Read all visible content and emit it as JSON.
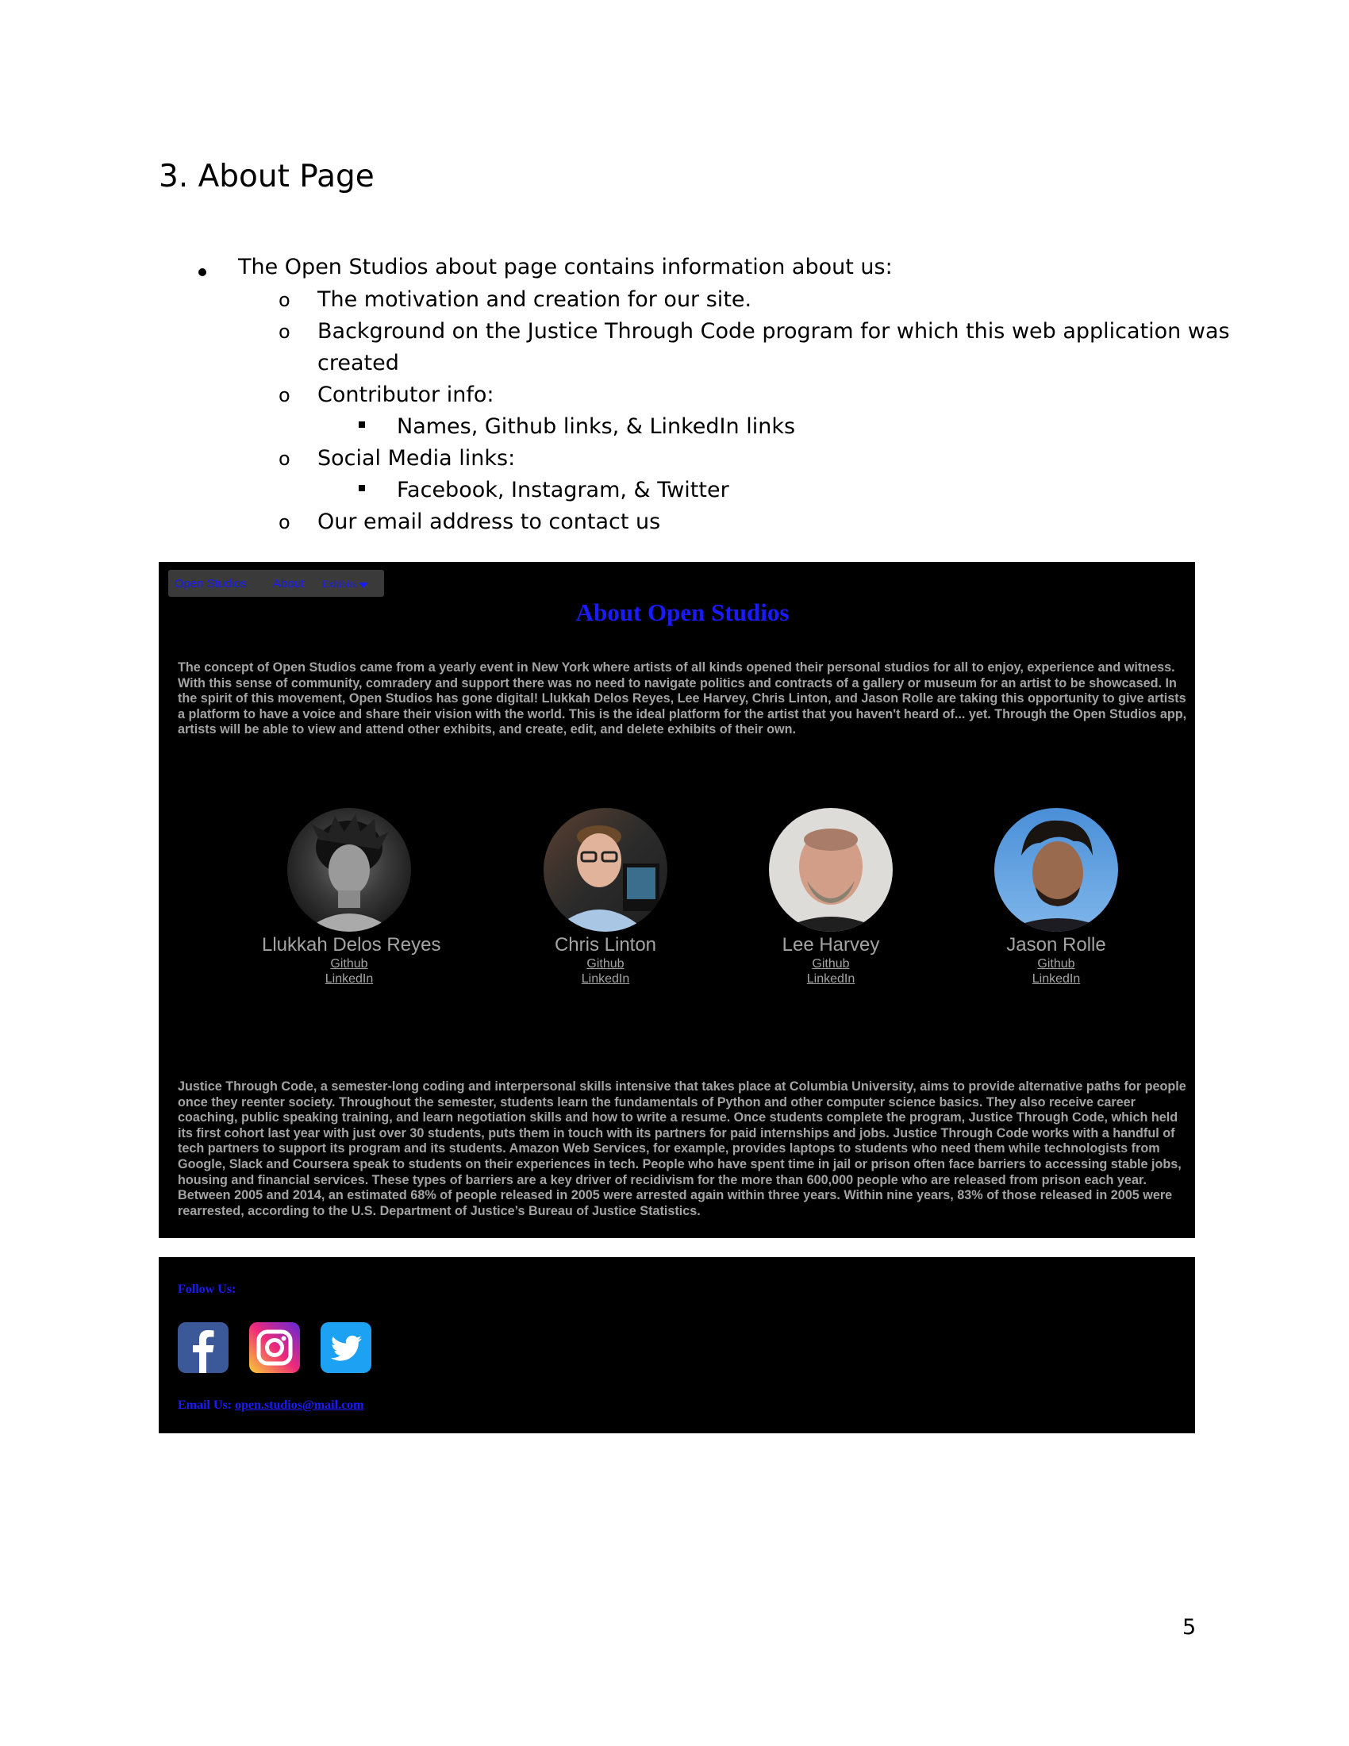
{
  "document": {
    "heading": "3.  About Page",
    "bullet_intro": "The Open Studios about page contains information about us:",
    "items": [
      "The motivation and creation for our site.",
      "Background on the Justice Through Code program for which this web application was",
      "created",
      "Contributor info:",
      "Names, Github links, & LinkedIn links",
      "Social Media links:",
      "Facebook, Instagram, & Twitter",
      "Our email address to contact us"
    ],
    "circle_marker": "o",
    "page_number": "5"
  },
  "screenshot": {
    "nav": {
      "brand": "Open Studios",
      "about": "About",
      "exhibits": "Exhibits"
    },
    "title": "About Open Studios",
    "intro_paragraph": "The concept of Open Studios came from a yearly event in New York where artists of all kinds opened their personal studios for all to enjoy, experience and witness. With this sense of community, comradery and support there was no need to navigate politics and contracts of a gallery or museum for an artist to be showcased. In the spirit of this movement, Open Studios has gone digital! Llukkah Delos Reyes, Lee Harvey, Chris Linton, and Jason Rolle are taking this opportunity to give artists a platform to have a voice and share their vision with the world. This is the ideal platform for the artist that you haven't heard of... yet. Through the Open Studios app, artists will be able to view and attend other exhibits, and create, edit, and delete exhibits of their own.",
    "members": [
      {
        "name": "Llukkah Delos Reyes",
        "github": "Github",
        "linkedin": "LinkedIn"
      },
      {
        "name": "Chris Linton",
        "github": "Github",
        "linkedin": "LinkedIn"
      },
      {
        "name": "Lee Harvey",
        "github": "Github",
        "linkedin": "LinkedIn"
      },
      {
        "name": "Jason Rolle",
        "github": "Github",
        "linkedin": "LinkedIn"
      }
    ],
    "jtc_paragraph": "Justice Through Code, a semester-long coding and interpersonal skills intensive that takes place at Columbia University, aims to provide alternative paths for people once they reenter society. Throughout the semester, students learn the fundamentals of Python and other computer science basics. They also receive career coaching, public speaking training, and learn negotiation skills and how to write a resume. Once students complete the program, Justice Through Code, which held its first cohort last year with just over 30 students, puts them in touch with its partners for paid internships and jobs. Justice Through Code works with a handful of tech partners to support its program and its students. Amazon Web Services, for example, provides laptops to students who need them while technologists from Google, Slack and Coursera speak to students on their experiences in tech. People who have spent time in jail or prison often face barriers to accessing stable jobs, housing and financial services. These types of barriers are a key driver of recidivism for the more than 600,000 people who are released from prison each year. Between 2005 and 2014, an estimated 68% of people released in 2005 were arrested again within three years. Within nine years, 83% of those released in 2005 were rearrested, according to the U.S. Department of Justice’s Bureau of Justice Statistics.",
    "footer": {
      "follow_label": "Follow Us:",
      "social_icons": [
        "facebook-icon",
        "instagram-icon",
        "twitter-icon"
      ],
      "email_prefix": "Email Us: ",
      "email": "open.studios@mail.com"
    },
    "colors": {
      "background": "#000000",
      "link_blue": "#1a1aff",
      "text_grey": "#a3a3a3",
      "navbar": "#3a3a3a"
    }
  }
}
